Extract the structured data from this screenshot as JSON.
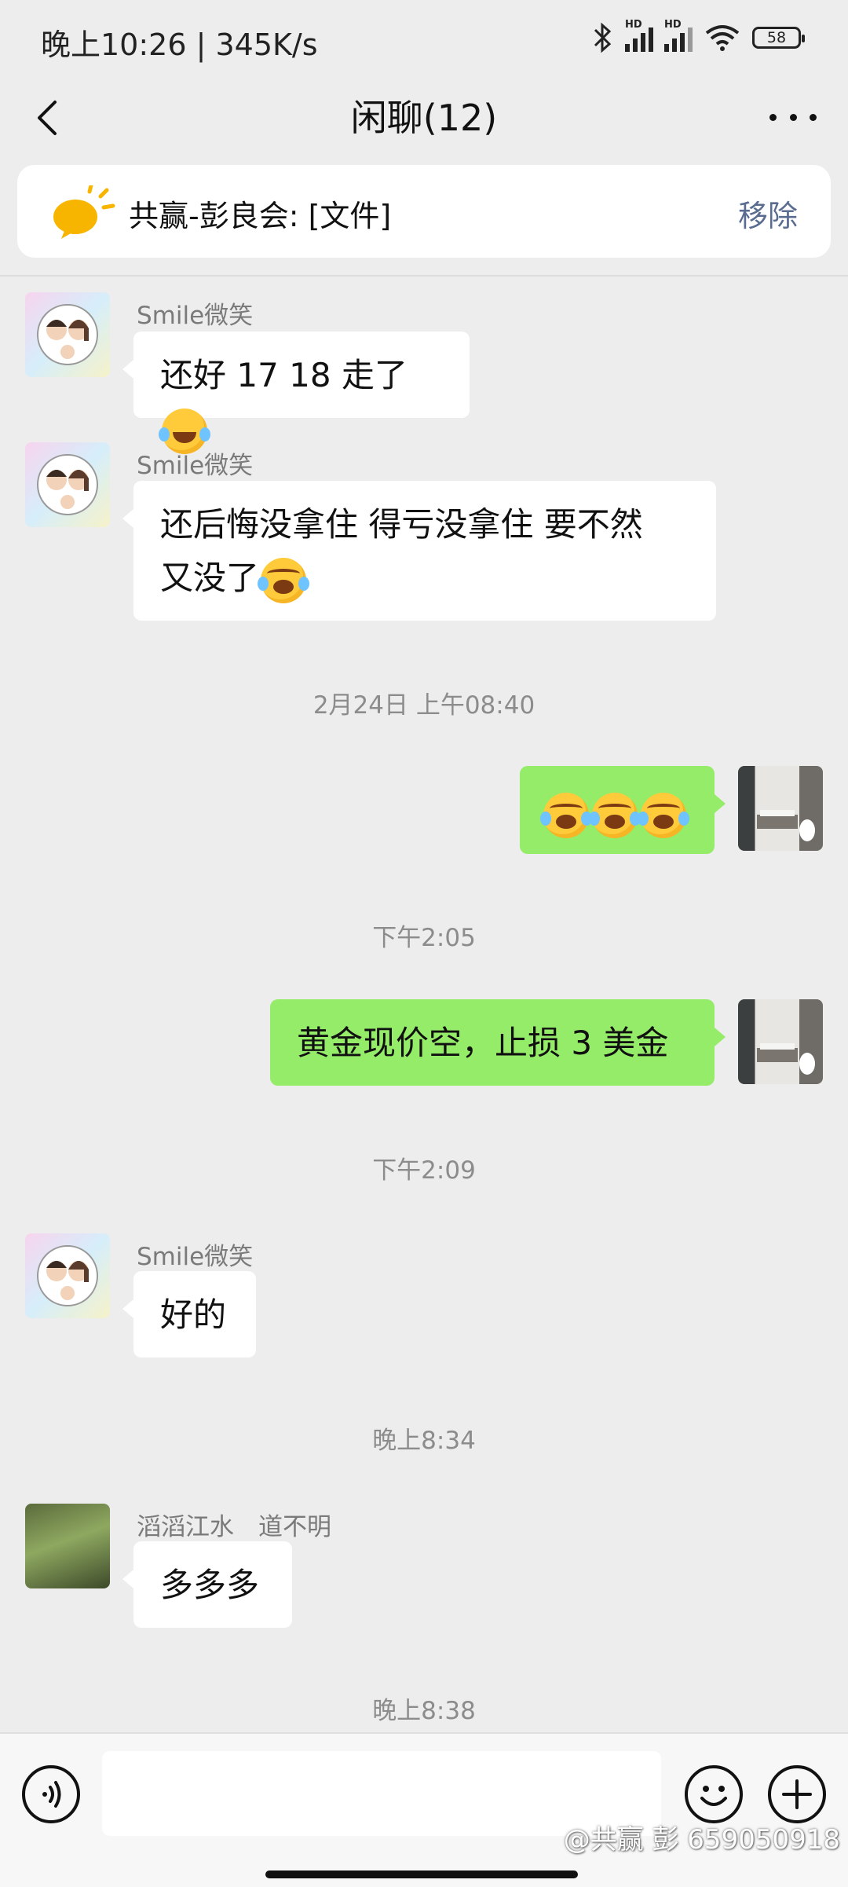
{
  "status_bar": {
    "time": "晚上10:26 | 345K/s",
    "battery": "58",
    "hd": "HD"
  },
  "header": {
    "title": "闲聊(12)"
  },
  "pinned": {
    "text": "共赢-彭良会: [文件]",
    "action": "移除"
  },
  "messages": [
    {
      "sender": "Smile微笑",
      "text": "还好 17 18 走了",
      "emoji": "laughing-tears"
    },
    {
      "sender": "Smile微笑",
      "text_line1": "还后悔没拿住 得亏没拿住 要不然",
      "text_line2": "又没了",
      "emoji": "crying-face"
    },
    {
      "timestamp": "2月24日 上午08:40"
    },
    {
      "sender": "self",
      "emoji": "crying-face x3"
    },
    {
      "timestamp": "下午2:05"
    },
    {
      "sender": "self",
      "text": "黄金现价空，止损 3 美金"
    },
    {
      "timestamp": "下午2:09"
    },
    {
      "sender": "Smile微笑",
      "text": "好的"
    },
    {
      "timestamp": "晚上8:34"
    },
    {
      "sender": "滔滔江水　道不明",
      "text": "多多多"
    },
    {
      "timestamp": "晚上8:38"
    }
  ],
  "watermark": "@共赢 彭 659050918",
  "colors": {
    "background": "#ededed",
    "self_bubble": "#95ec69",
    "link": "#5a6d90"
  }
}
